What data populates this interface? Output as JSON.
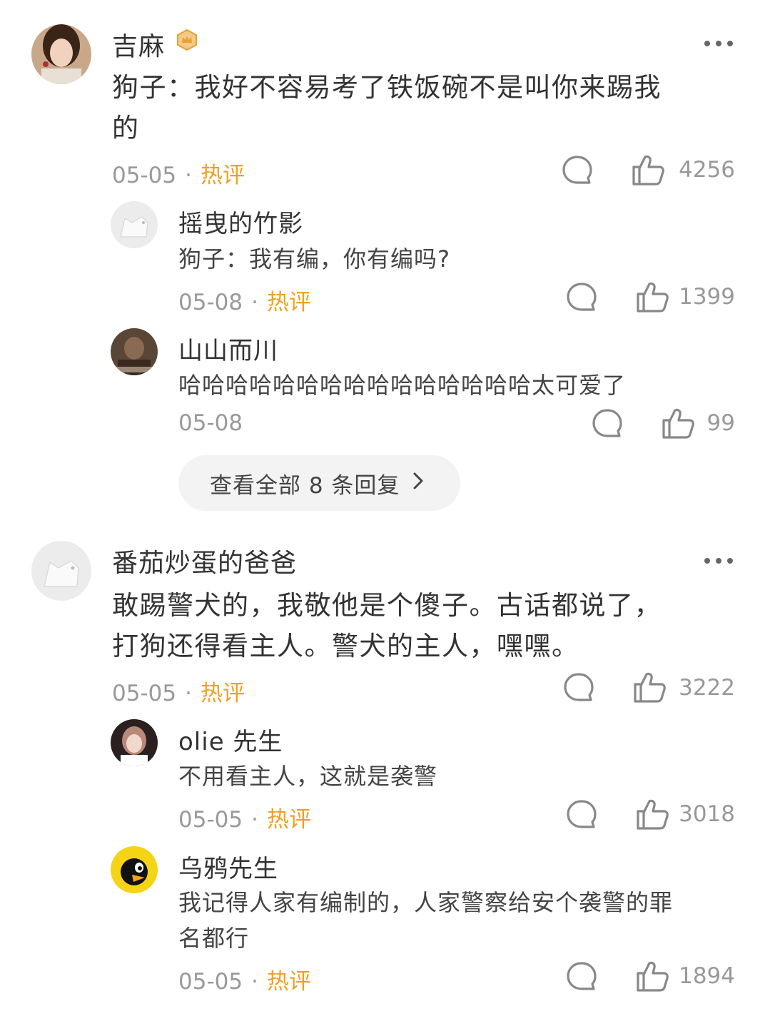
{
  "threads": [
    {
      "author": "吉麻",
      "text_line1": "狗子：我好不容易考了铁饭碗不是叫你来踢我",
      "text_line2": "的",
      "date": "05-05",
      "tag": "热评",
      "likes": "4256",
      "more_icon": "ellipsis-icon",
      "replies": [
        {
          "author": "摇曳的竹影",
          "text": "狗子：我有编，你有编吗?",
          "date": "05-08",
          "tag": "热评",
          "likes": "1399"
        },
        {
          "author": "山山而川",
          "text": "哈哈哈哈哈哈哈哈哈哈哈哈哈哈哈太可爱了",
          "date": "05-08",
          "tag": "",
          "likes": "99"
        }
      ],
      "view_all": "查看全部 8 条回复"
    },
    {
      "author": "番茄炒蛋的爸爸",
      "text_line1": "敢踢警犬的，我敬他是个傻子。古话都说了，",
      "text_line2": "打狗还得看主人。警犬的主人，嘿嘿。",
      "date": "05-05",
      "tag": "热评",
      "likes": "3222",
      "replies": [
        {
          "author": "olie 先生",
          "text": "不用看主人，这就是袭警",
          "date": "05-05",
          "tag": "热评",
          "likes": "3018"
        },
        {
          "author": "乌鸦先生",
          "text_line1": "我记得人家有编制的，人家警察给安个袭警的罪",
          "text_line2": "名都行",
          "date": "05-05",
          "tag": "热评",
          "likes": "1894"
        }
      ]
    }
  ],
  "separator_dot": "·",
  "colors": {
    "hot_tag": "#f0a020",
    "meta": "#999999",
    "badge": "#e8a030"
  }
}
